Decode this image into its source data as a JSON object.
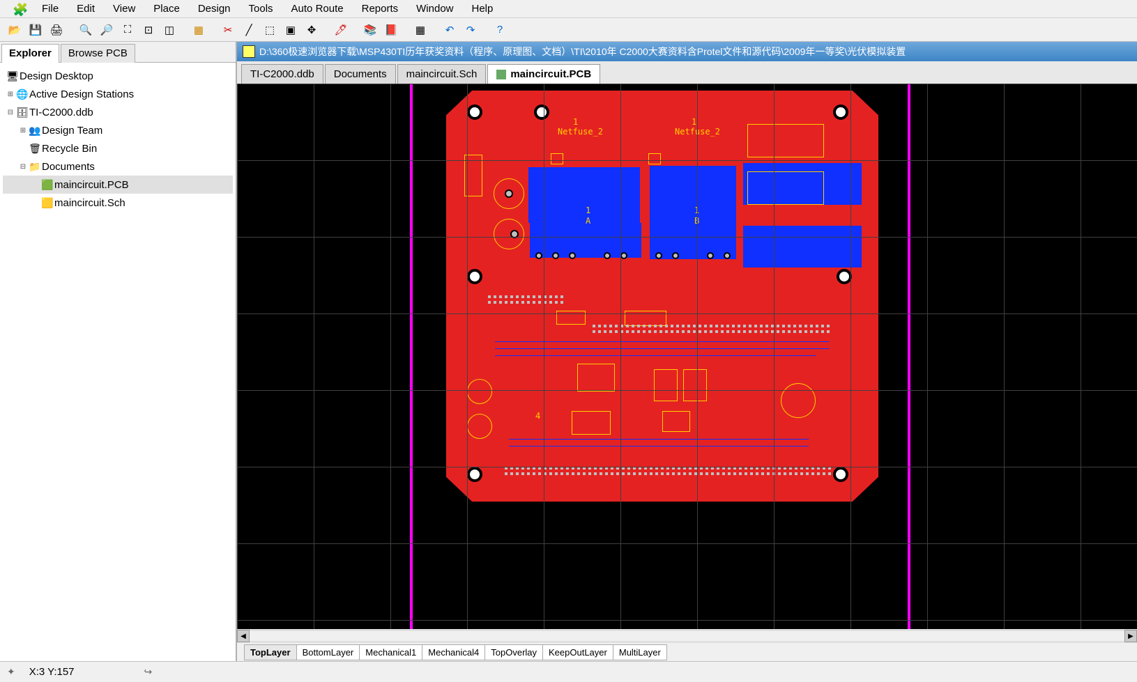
{
  "menu": [
    "File",
    "Edit",
    "View",
    "Place",
    "Design",
    "Tools",
    "Auto Route",
    "Reports",
    "Window",
    "Help"
  ],
  "left_tabs": [
    "Explorer",
    "Browse PCB"
  ],
  "tree": {
    "root": "Design Desktop",
    "n1": "Active Design Stations",
    "n2": "TI-C2000.ddb",
    "n3": "Design Team",
    "n4": "Recycle Bin",
    "n5": "Documents",
    "n6": "maincircuit.PCB",
    "n7": "maincircuit.Sch"
  },
  "title_path": "D:\\360极速浏览器下载\\MSP430TI历年获奖资料（程序、原理图、文档）\\TI\\2010年 C2000大赛资料含Protel文件和源代码\\2009年一等奖\\光伏模拟装置",
  "doc_tabs": [
    "TI-C2000.ddb",
    "Documents",
    "maincircuit.Sch",
    "maincircuit.PCB"
  ],
  "layer_tabs": [
    "TopLayer",
    "BottomLayer",
    "Mechanical1",
    "Mechanical4",
    "TopOverlay",
    "KeepOutLayer",
    "MultiLayer"
  ],
  "silk": {
    "nf2a": "Netfuse_2",
    "nf2b": "Netfuse_2",
    "one_a": "1",
    "one_b": "1",
    "lblA": "A",
    "lblB": "B",
    "lbl1c": "1",
    "lbl1d": "1",
    "lbl4": "4"
  },
  "status": {
    "coord": "X:3 Y:157"
  }
}
